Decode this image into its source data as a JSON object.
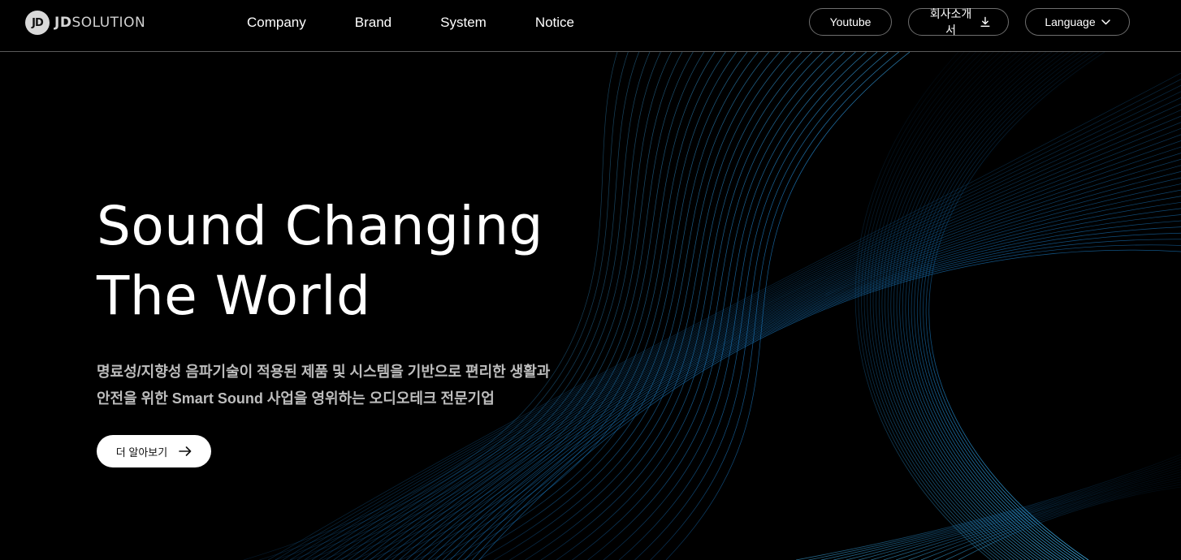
{
  "brand": {
    "logo_mark": "JD",
    "name_bold": "JD",
    "name_light": "SOLUTION"
  },
  "nav": {
    "items": [
      {
        "label": "Company"
      },
      {
        "label": "Brand"
      },
      {
        "label": "System"
      },
      {
        "label": "Notice"
      }
    ]
  },
  "header_actions": {
    "youtube_label": "Youtube",
    "brochure_label": "회사소개서",
    "brochure_icon": "download-icon",
    "language_label": "Language",
    "language_icon": "chevron-down-icon"
  },
  "hero": {
    "title_line1": "Sound Changing",
    "title_line2": "The World",
    "desc_line1": "명료성/지향성 음파기술이 적용된 제품 및 시스템을 기반으로 편리한 생활과",
    "desc_line2": "안전을 위한 Smart Sound 사업을 영위하는 오디오테크 전문기업",
    "cta_label": "더 알아보기",
    "cta_icon": "arrow-right-icon"
  },
  "colors": {
    "background": "#000000",
    "wave_primary": "#1e88d6",
    "wave_light": "#3fb8ff",
    "text_primary": "#ffffff",
    "text_secondary": "#bdbdbd"
  }
}
